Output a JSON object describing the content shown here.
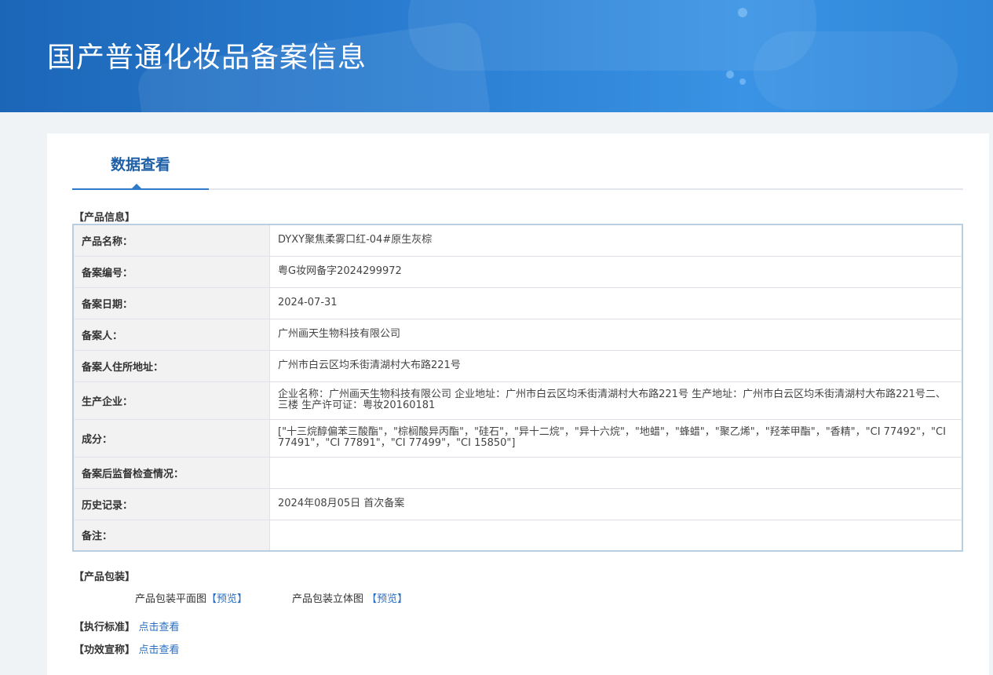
{
  "header": {
    "title": "国产普通化妆品备案信息"
  },
  "tabs": {
    "active": "数据查看"
  },
  "product_info": {
    "section_title": "【产品信息】",
    "rows": [
      {
        "label": "产品名称：",
        "value": "DYXY聚焦柔雾口红-04#原生灰棕"
      },
      {
        "label": "备案编号：",
        "value": "粤G妆网备字2024299972"
      },
      {
        "label": "备案日期：",
        "value": "2024-07-31"
      },
      {
        "label": "备案人：",
        "value": "广州画天生物科技有限公司"
      },
      {
        "label": "备案人住所地址：",
        "value": "广州市白云区均禾街清湖村大布路221号"
      },
      {
        "label": "生产企业：",
        "value": "企业名称：广州画天生物科技有限公司 企业地址：广州市白云区均禾街清湖村大布路221号 生产地址：广州市白云区均禾街清湖村大布路221号二、三楼 生产许可证：粤妆20160181"
      },
      {
        "label": "成分：",
        "value": "[\"十三烷醇偏苯三酸酯\"，\"棕榈酸异丙酯\"，\"硅石\"，\"异十二烷\"，\"异十六烷\"，\"地蜡\"，\"蜂蜡\"，\"聚乙烯\"，\"羟苯甲酯\"，\"香精\"，\"CI 77492\"，\"CI 77491\"，\"CI 77891\"，\"CI 77499\"，\"CI 15850\"]"
      },
      {
        "label": "备案后监督检查情况：",
        "value": ""
      },
      {
        "label": "历史记录：",
        "value": "2024年08月05日 首次备案"
      },
      {
        "label": "备注：",
        "value": ""
      }
    ]
  },
  "packaging": {
    "section_title": "【产品包装】",
    "flat_label": "产品包装平面图",
    "flat_link": "【预览】",
    "solid_label": "产品包装立体图",
    "solid_link": "【预览】"
  },
  "standard": {
    "label": "【执行标准】",
    "link": "点击查看"
  },
  "claims": {
    "label": "【功效宣称】",
    "link": "点击查看"
  }
}
